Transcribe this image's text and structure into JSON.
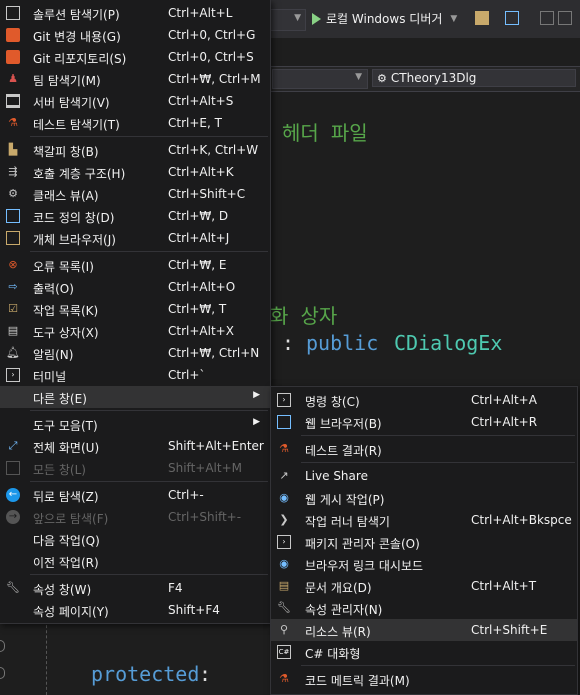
{
  "toolbar": {
    "debugger_label": "로컬 Windows 디버거"
  },
  "navbar": {
    "class_combo": "CTheory13Dlg"
  },
  "code": {
    "line1": "헤더 파일",
    "line2_comment": "화 상자",
    "colon": ":",
    "public_kw": "public",
    "base_class": "CDialogEx",
    "protected_kw": "protected",
    "protected_colon": ":"
  },
  "main_menu": [
    {
      "label": "솔루션 탐색기(P)",
      "shortcut": "Ctrl+Alt+L",
      "icon": "solution-explorer-icon"
    },
    {
      "label": "Git 변경 내용(G)",
      "shortcut": "Ctrl+0, Ctrl+G",
      "icon": "git-changes-icon"
    },
    {
      "label": "Git 리포지토리(S)",
      "shortcut": "Ctrl+0, Ctrl+S",
      "icon": "git-repository-icon"
    },
    {
      "label": "팀 탐색기(M)",
      "shortcut": "Ctrl+₩, Ctrl+M",
      "icon": "team-explorer-icon"
    },
    {
      "label": "서버 탐색기(V)",
      "shortcut": "Ctrl+Alt+S",
      "icon": "server-explorer-icon"
    },
    {
      "label": "테스트 탐색기(T)",
      "shortcut": "Ctrl+E, T",
      "icon": "test-explorer-icon"
    },
    {
      "label": "책갈피 창(B)",
      "shortcut": "Ctrl+K, Ctrl+W",
      "icon": "bookmark-icon"
    },
    {
      "label": "호출 계층 구조(H)",
      "shortcut": "Ctrl+Alt+K",
      "icon": "call-hierarchy-icon"
    },
    {
      "label": "클래스 뷰(A)",
      "shortcut": "Ctrl+Shift+C",
      "icon": "class-view-icon"
    },
    {
      "label": "코드 정의 창(D)",
      "shortcut": "Ctrl+₩, D",
      "icon": "code-definition-icon"
    },
    {
      "label": "개체 브라우저(J)",
      "shortcut": "Ctrl+Alt+J",
      "icon": "object-browser-icon"
    },
    {
      "label": "오류 목록(I)",
      "shortcut": "Ctrl+₩, E",
      "icon": "error-list-icon"
    },
    {
      "label": "출력(O)",
      "shortcut": "Ctrl+Alt+O",
      "icon": "output-icon"
    },
    {
      "label": "작업 목록(K)",
      "shortcut": "Ctrl+₩, T",
      "icon": "task-list-icon"
    },
    {
      "label": "도구 상자(X)",
      "shortcut": "Ctrl+Alt+X",
      "icon": "toolbox-icon"
    },
    {
      "label": "알림(N)",
      "shortcut": "Ctrl+₩, Ctrl+N",
      "icon": "notification-bell-icon"
    },
    {
      "label": "터미널",
      "shortcut": "Ctrl+`",
      "icon": "terminal-icon"
    },
    {
      "label": "다른 창(E)",
      "shortcut": "",
      "icon": ""
    },
    {
      "label": "도구 모음(T)",
      "shortcut": "",
      "icon": ""
    },
    {
      "label": "전체 화면(U)",
      "shortcut": "Shift+Alt+Enter",
      "icon": "fullscreen-icon"
    },
    {
      "label": "모든 창(L)",
      "shortcut": "Shift+Alt+M",
      "icon": "all-windows-icon"
    },
    {
      "label": "뒤로 탐색(Z)",
      "shortcut": "Ctrl+-",
      "icon": "navigate-back-icon"
    },
    {
      "label": "앞으로 탐색(F)",
      "shortcut": "Ctrl+Shift+-",
      "icon": "navigate-forward-icon"
    },
    {
      "label": "다음 작업(Q)",
      "shortcut": "",
      "icon": ""
    },
    {
      "label": "이전 작업(R)",
      "shortcut": "",
      "icon": ""
    },
    {
      "label": "속성 창(W)",
      "shortcut": "F4",
      "icon": "properties-wrench-icon"
    },
    {
      "label": "속성 페이지(Y)",
      "shortcut": "Shift+F4",
      "icon": ""
    }
  ],
  "sub_menu": [
    {
      "label": "명령 창(C)",
      "shortcut": "Ctrl+Alt+A",
      "icon": "command-window-icon"
    },
    {
      "label": "웹 브라우저(B)",
      "shortcut": "Ctrl+Alt+R",
      "icon": "web-browser-icon"
    },
    {
      "label": "테스트 결과(R)",
      "shortcut": "",
      "icon": "test-results-icon"
    },
    {
      "label": "Live Share",
      "shortcut": "",
      "icon": "live-share-icon"
    },
    {
      "label": "웹 게시 작업(P)",
      "shortcut": "",
      "icon": "web-publish-icon"
    },
    {
      "label": "작업 러너 탐색기",
      "shortcut": "Ctrl+Alt+Bkspce",
      "icon": "task-runner-icon"
    },
    {
      "label": "패키지 관리자 콘솔(O)",
      "shortcut": "",
      "icon": "package-console-icon"
    },
    {
      "label": "브라우저 링크 대시보드",
      "shortcut": "",
      "icon": "browser-link-icon"
    },
    {
      "label": "문서 개요(D)",
      "shortcut": "Ctrl+Alt+T",
      "icon": "document-outline-icon"
    },
    {
      "label": "속성 관리자(N)",
      "shortcut": "",
      "icon": "property-manager-icon"
    },
    {
      "label": "리소스 뷰(R)",
      "shortcut": "Ctrl+Shift+E",
      "icon": "resource-view-icon"
    },
    {
      "label": "C# 대화형",
      "shortcut": "",
      "icon": "csharp-interactive-icon"
    },
    {
      "label": "코드 메트릭 결과(M)",
      "shortcut": "",
      "icon": "code-metrics-icon"
    }
  ]
}
